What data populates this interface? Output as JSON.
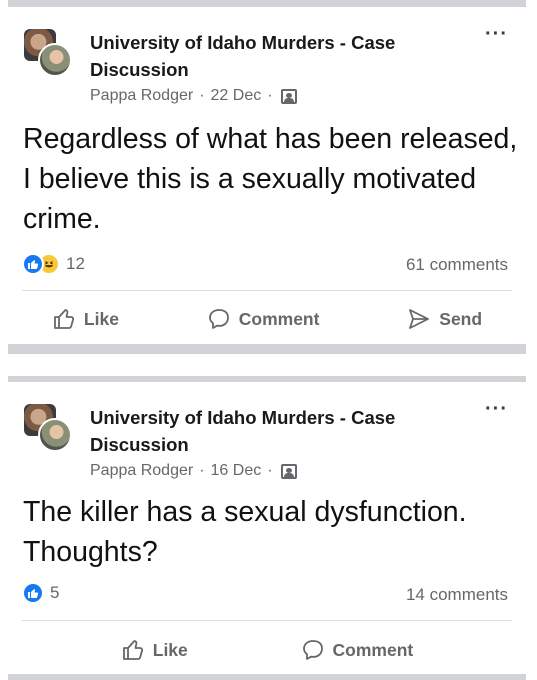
{
  "posts": [
    {
      "group_name": "University of Idaho Murders - Case Discussion",
      "author": "Pappa Rodger",
      "date": "22 Dec",
      "separator": "·",
      "text": "Regardless of what has been released, I believe this is a sexually motivated crime.",
      "reactions": [
        "like-icon",
        "haha-icon"
      ],
      "reaction_count": "12",
      "comments_count": "61 comments",
      "actions": {
        "like": "Like",
        "comment": "Comment",
        "send": "Send"
      }
    },
    {
      "group_name": "University of Idaho Murders - Case Discussion",
      "author": "Pappa Rodger",
      "date": "16 Dec",
      "separator": "·",
      "text": "The killer has a sexual dysfunction. Thoughts?",
      "reactions": [
        "like-icon"
      ],
      "reaction_count": "5",
      "comments_count": "14 comments",
      "actions": {
        "like": "Like",
        "comment": "Comment"
      }
    }
  ],
  "colors": {
    "like_blue": "#1877f2",
    "haha_yellow": "#f7c83a",
    "meta_gray": "#65676b",
    "separator_gray": "#d2d3d7"
  }
}
